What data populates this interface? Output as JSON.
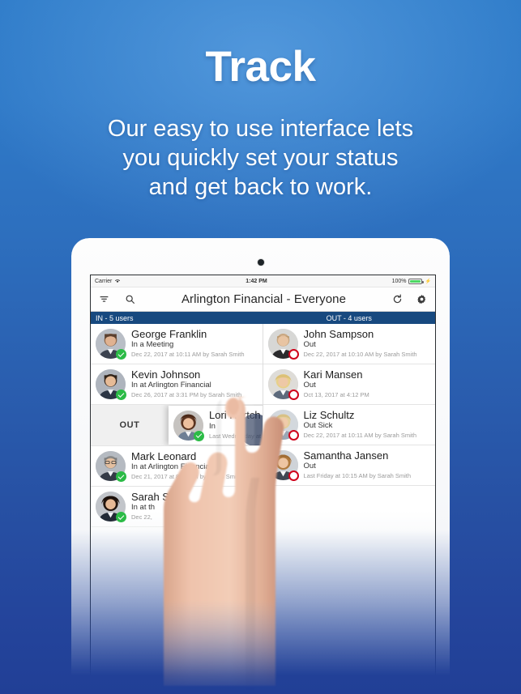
{
  "promo": {
    "title": "Track",
    "subtitle_lines": [
      "Our easy to use interface lets",
      "you quickly set your status",
      "and get back to work."
    ]
  },
  "device": {
    "status_bar": {
      "carrier": "Carrier",
      "wifi_icon": "wifi-icon",
      "time": "1:42 PM",
      "battery_percent": "100%",
      "charging_icon": "lightning-bolt-icon"
    },
    "navbar": {
      "title": "Arlington Financial - Everyone",
      "filter_icon": "filter-icon",
      "search_icon": "search-icon",
      "refresh_icon": "refresh-icon",
      "settings_icon": "gear-icon"
    },
    "section_header": {
      "in_label": "IN - 5 users",
      "out_label": "OUT - 4 users"
    },
    "swipe_action_label": "OUT",
    "in_column": [
      {
        "name": "George Franklin",
        "status": "In a Meeting",
        "stamp": "Dec 22, 2017 at 10:11 AM by Sarah Smith",
        "badge": "in"
      },
      {
        "name": "Kevin Johnson",
        "status": "In at Arlington Financial",
        "stamp": "Dec 26, 2017 at 3:31 PM by Sarah Smith",
        "badge": "in"
      },
      {
        "name": "Lori Hertch",
        "status": "In",
        "stamp": "Last Wednesday at 2:31 P",
        "badge": "in",
        "swiped": true
      },
      {
        "name": "Mark Leonard",
        "status": "In at Arlington Financial",
        "stamp": "Dec 21, 2017 at 8:17 AM by Sarah Smith",
        "badge": "in"
      },
      {
        "name": "Sarah Sm",
        "status": "In at th",
        "stamp": "Dec 22,",
        "badge": "in"
      }
    ],
    "out_column": [
      {
        "name": "John Sampson",
        "status": "Out",
        "stamp": "Dec 22, 2017 at 10:10 AM by Sarah Smith",
        "badge": "out"
      },
      {
        "name": "Kari Mansen",
        "status": "Out",
        "stamp": "Oct 13, 2017 at 4:12 PM",
        "badge": "out"
      },
      {
        "name": "Liz Schultz",
        "status": "Out Sick",
        "stamp": "Dec 22, 2017 at 10:11 AM by Sarah Smith",
        "badge": "out"
      },
      {
        "name": "Samantha Jansen",
        "status": "Out",
        "stamp": "Last Friday at 10:15 AM by Sarah Smith",
        "badge": "out"
      }
    ]
  },
  "colors": {
    "bg_top": "#2f7ac8",
    "bg_bottom": "#213f96",
    "section_header": "#17497f",
    "badge_in": "#2bbb46",
    "badge_out": "#d0021b",
    "battery_green": "#4cd763"
  }
}
